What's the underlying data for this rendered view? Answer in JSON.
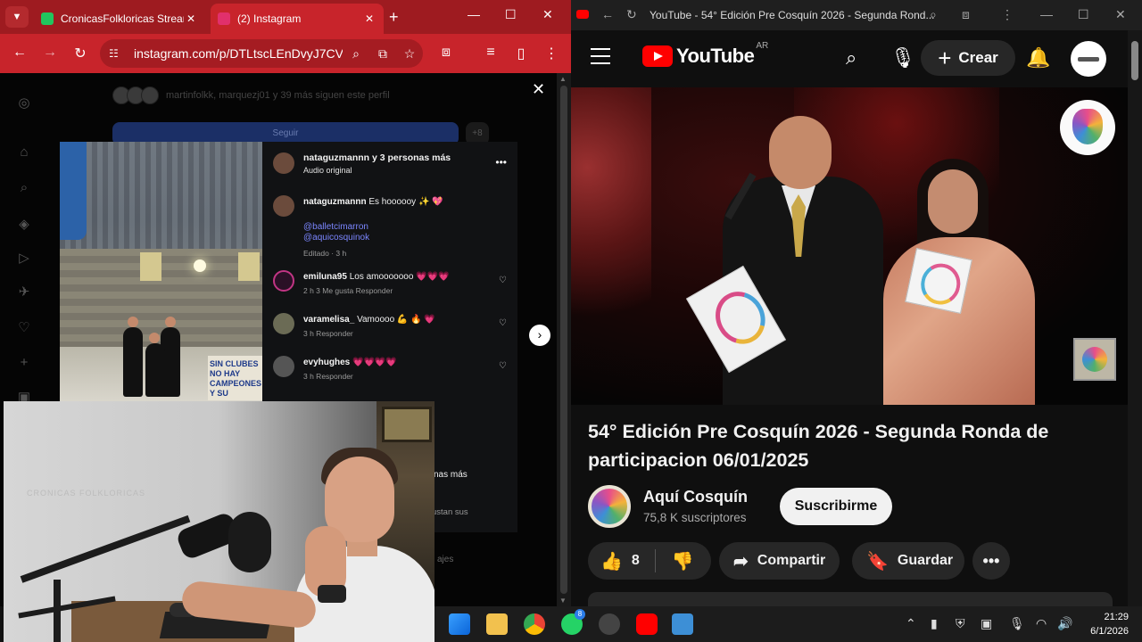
{
  "chrome": {
    "tabs": [
      {
        "title": "CronicasFolkloricas Stream",
        "favicon_color": "#22c55e",
        "active": false
      },
      {
        "title": "(2) Instagram",
        "favicon_color": "#e1306c",
        "active": true
      }
    ],
    "url": "instagram.com/p/DTLtscLEnDvyJ7CV..."
  },
  "instagram": {
    "followed_by": "martinfolkk, marquezj01 y 39 más siguen este perfil",
    "follow_button": "Seguir",
    "post_header": {
      "user": "nataguzmannn y 3 personas más",
      "audio": "Audio original"
    },
    "caption": {
      "user": "nataguzmannn",
      "text": "Es hoooooy ✨ 💖",
      "mentions": [
        "@balletcimarron",
        "@aquicosquinok"
      ],
      "meta": "Editado · 3 h"
    },
    "comments": [
      {
        "user": "emiluna95",
        "text": "Los amooooooo 💗💗💗",
        "meta": "2 h   3 Me gusta   Responder"
      },
      {
        "user": "varamelisa_",
        "text": "Vamoooo 💪 🔥 💗",
        "meta": "3 h   Responder"
      },
      {
        "user": "evyhughes",
        "text": "💗💗💗💗",
        "meta": "3 h   Responder"
      }
    ],
    "tail_text_1": "nas más",
    "tail_text_2": "ustan sus",
    "messages_label": "ajes",
    "banner_text": "SIN CLUBES NO HAY CAMPEONES Y SU"
  },
  "webcam": {
    "overlay_text": "CRONICAS FOLKLORICAS"
  },
  "youtube": {
    "window_title": "YouTube - 54° Edición Pre Cosquín 2026 - Segunda Rond...",
    "brand": "YouTube",
    "region": "AR",
    "create_label": "Crear",
    "video_title": "54° Edición Pre Cosquín 2026 - Segunda Ronda de participacion 06/01/2025",
    "channel_name": "Aquí Cosquín",
    "subscribers": "75,8 K suscriptores",
    "subscribe_label": "Suscribirme",
    "likes": "8",
    "share_label": "Compartir",
    "save_label": "Guardar"
  },
  "taskbar": {
    "time": "21:29",
    "date": "6/1/2026",
    "whatsapp_badge": "8"
  },
  "colors": {
    "chrome_frame": "#9e1b20",
    "chrome_toolbar": "#c8242b",
    "youtube_red": "#ff0000",
    "instagram_link": "#7b86ff"
  }
}
